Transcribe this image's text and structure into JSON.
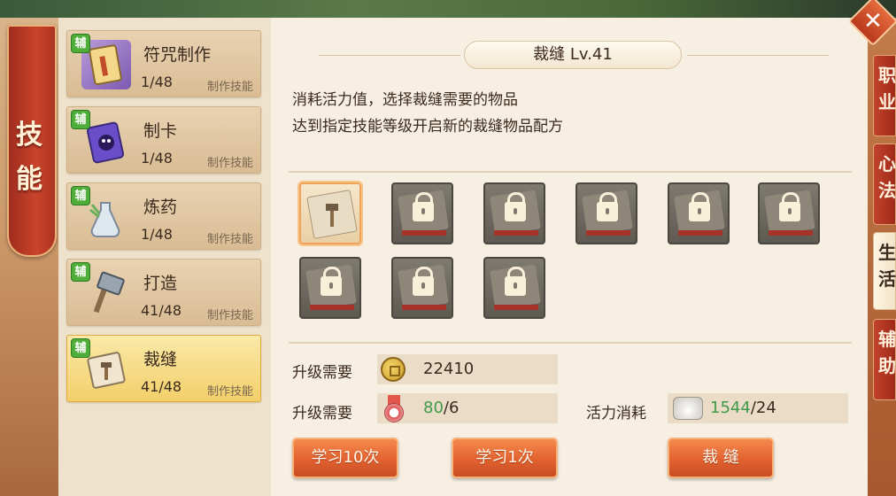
{
  "side_tab": {
    "label": "技能"
  },
  "skills": [
    {
      "tag": "辅",
      "name": "符咒制作",
      "progress": "1/48",
      "type": "制作技能",
      "icon": "talisman-icon"
    },
    {
      "tag": "辅",
      "name": "制卡",
      "progress": "1/48",
      "type": "制作技能",
      "icon": "card-icon"
    },
    {
      "tag": "辅",
      "name": "炼药",
      "progress": "1/48",
      "type": "制作技能",
      "icon": "potion-icon"
    },
    {
      "tag": "辅",
      "name": "打造",
      "progress": "41/48",
      "type": "制作技能",
      "icon": "hammer-icon"
    },
    {
      "tag": "辅",
      "name": "裁缝",
      "progress": "41/48",
      "type": "制作技能",
      "icon": "tailor-scroll-icon",
      "selected": true
    }
  ],
  "detail": {
    "title": "裁缝  Lv.41",
    "desc_line1": "消耗活力值，选择裁缝需要的物品",
    "desc_line2": "达到指定技能等级开启新的裁缝物品配方"
  },
  "recipes": [
    {
      "state": "unlocked",
      "icon": "tailor-scroll-icon"
    },
    {
      "state": "locked",
      "icon": "lock-icon"
    },
    {
      "state": "locked",
      "icon": "lock-icon"
    },
    {
      "state": "locked",
      "icon": "lock-icon"
    },
    {
      "state": "locked",
      "icon": "lock-icon"
    },
    {
      "state": "locked",
      "icon": "lock-icon"
    },
    {
      "state": "locked",
      "icon": "lock-icon"
    },
    {
      "state": "locked",
      "icon": "lock-icon"
    },
    {
      "state": "locked",
      "icon": "lock-icon"
    }
  ],
  "costs": {
    "upgrade_label": "升级需要",
    "coin_amount": "22410",
    "upgrade_label_2": "升级需要",
    "medal_have": "80",
    "medal_need": "/6",
    "energy_label": "活力消耗",
    "energy_have": "1544",
    "energy_need": "/24"
  },
  "buttons": {
    "learn10": "学习10次",
    "learn1": "学习1次",
    "craft": "裁 缝"
  },
  "right_tabs": [
    {
      "text": "职业",
      "active": false
    },
    {
      "text": "心法",
      "active": false
    },
    {
      "text": "生活",
      "active": true
    },
    {
      "text": "辅助",
      "active": false
    }
  ],
  "colors": {
    "accent_orange": "#e2622f",
    "selected_gold": "#f3cf6a",
    "value_green": "#3f9a4a"
  }
}
